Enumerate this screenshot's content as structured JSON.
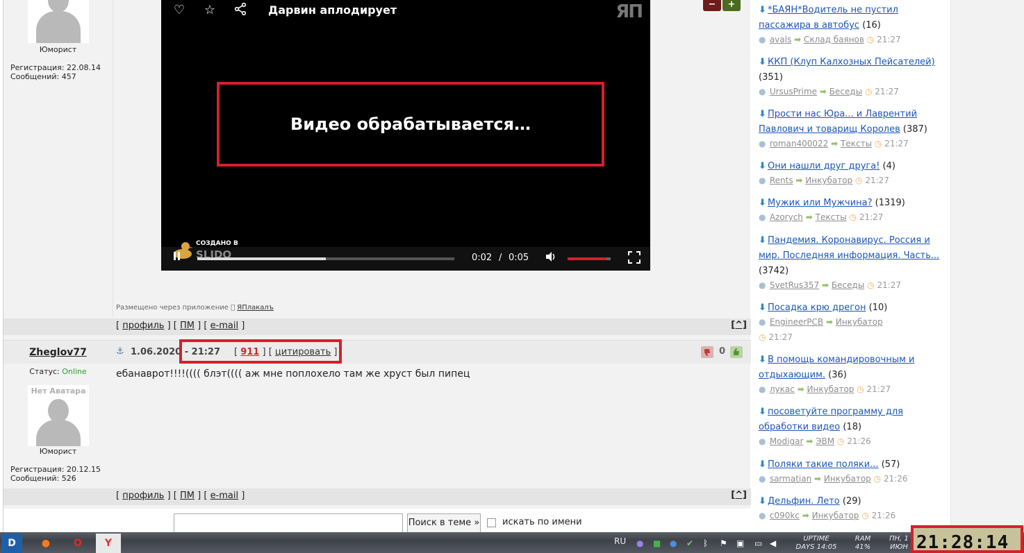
{
  "users": [
    {
      "rank": "Юморист",
      "reg": "Регистрация: 22.08.14",
      "posts": "Сообщений: 457"
    },
    {
      "name": "Zheglov77",
      "status_label": "Статус:",
      "status_value": "Online",
      "avatar_text": "Нет Аватара",
      "rank": "Юморист",
      "reg": "Регистрация: 20.12.15",
      "posts": "Сообщений: 526"
    }
  ],
  "video": {
    "title": "Дарвин аплодирует",
    "logo": "ЯП",
    "processing": "Видео обрабатывается…",
    "made_in": "СОЗДАНО В",
    "made_brand": "SLIDO",
    "time_current": "0:02",
    "time_sep": "/",
    "time_total": "0:05",
    "progress": 0.5,
    "volume": 0.9
  },
  "posted_via": {
    "prefix": "Размещено через приложение",
    "app": "ЯПлакалъ"
  },
  "bar_links": {
    "profile": "профиль",
    "pm": "ПМ",
    "email": "e-mail",
    "up": "[^]"
  },
  "post": {
    "date": "1.06.2020 - 21:27",
    "number": "911",
    "quote": "цитировать",
    "rating": "0",
    "text": "ебанаврот!!!!(((( блэт(((( аж мне поплохело там же хруст был пипец"
  },
  "search": {
    "button": "Поиск в теме »",
    "by_name": "искать по имени"
  },
  "zoom": {
    "minus": "−",
    "plus": "+"
  },
  "topics": [
    {
      "title": "*БАЯН*Водитель не пустил пассажира в автобус",
      "count": "(16)",
      "user": "avals",
      "section": "Склад баянов",
      "time": "21:27"
    },
    {
      "title": "ККП (Клуп Калхозных Пейсателей)",
      "count": "(351)",
      "user": "UrsusPrime",
      "section": "Беседы",
      "time": "21:27"
    },
    {
      "title": "Прости нас Юра... и Лаврентий Павлович и товарищ Королев",
      "count": "(387)",
      "user": "roman400022",
      "section": "Тексты",
      "time": "21:27"
    },
    {
      "title": "Они нашли друг друга!",
      "count": "(4)",
      "user": "Rents",
      "section": "Инкубатор",
      "time": "21:27"
    },
    {
      "title": "Мужик или Мужчина?",
      "count": "(1319)",
      "user": "Azorych",
      "section": "Тексты",
      "time": "21:27"
    },
    {
      "title": "Пандемия. Коронавирус. Россия и мир. Последняя информация. Часть...",
      "count": "(3742)",
      "user": "SvetRus357",
      "section": "Беседы",
      "time": "21:27"
    },
    {
      "title": "Посадка крю дрегон",
      "count": "(10)",
      "user": "EngineerPCB",
      "section": "Инкубатор",
      "time": "21:27"
    },
    {
      "title": "В помощь командировочным и отдыхающим.",
      "count": "(36)",
      "user": "лукас",
      "section": "Инкубатор",
      "time": "21:27"
    },
    {
      "title": "посоветуйте программу для обработки видео",
      "count": "(18)",
      "user": "Modigar",
      "section": "ЭВМ",
      "time": "21:26"
    },
    {
      "title": "Поляки такие поляки...",
      "count": "(57)",
      "user": "sarmatian",
      "section": "Инкубатор",
      "time": "21:26"
    },
    {
      "title": "Дельфин. Лето",
      "count": "(29)",
      "user": "c090kc",
      "section": "Инкубатор",
      "time": "21:26"
    }
  ],
  "taskbar": {
    "lang": "RU",
    "uptime_label": "UPTIME",
    "uptime_value": "DAYS 14:05",
    "ram_label": "RAM",
    "ram_value": "41%",
    "day_label": "ПН, 1",
    "month_label": "ИЮН",
    "clock": "21:28:14"
  },
  "colors": {
    "highlight": "#d5202b",
    "link": "#1a56b8",
    "online": "#2ca02c",
    "topic_arrow": "#2c86d1"
  }
}
